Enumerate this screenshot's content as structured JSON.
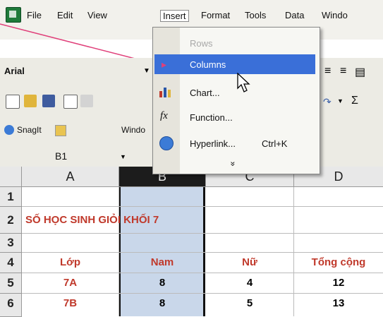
{
  "menubar": {
    "items": [
      "File",
      "Edit",
      "View",
      "Insert",
      "Format",
      "Tools",
      "Data",
      "Windo"
    ]
  },
  "font_toolbar": {
    "font_name": "Arial"
  },
  "standard_toolbar": {
    "sigma": "Σ"
  },
  "snagit_toolbar": {
    "snagit_label": "SnagIt",
    "window_label": "Windo"
  },
  "formula_bar": {
    "name_box": "B1"
  },
  "insert_menu": {
    "items": [
      {
        "label": "Rows",
        "shortcut": "",
        "disabled": true
      },
      {
        "label": "Columns",
        "shortcut": "",
        "highlighted": true
      },
      {
        "label": "Chart...",
        "shortcut": ""
      },
      {
        "label": "Function...",
        "shortcut": ""
      },
      {
        "label": "Hyperlink...",
        "shortcut": "Ctrl+K"
      }
    ],
    "more_chevron": "»"
  },
  "sheet": {
    "columns": [
      "A",
      "B",
      "C",
      "D"
    ],
    "rows": [
      {
        "n": "1",
        "cells": [
          "",
          "",
          "",
          ""
        ]
      },
      {
        "n": "2",
        "title": "SỐ HỌC SINH GIỎI KHỐI 7"
      },
      {
        "n": "3",
        "cells": [
          "",
          "",
          "",
          ""
        ]
      },
      {
        "n": "4",
        "cells": [
          "Lớp",
          "Nam",
          "Nữ",
          "Tổng cộng"
        ]
      },
      {
        "n": "5",
        "cells": [
          "7A",
          "8",
          "4",
          "12"
        ]
      },
      {
        "n": "6",
        "cells": [
          "7B",
          "8",
          "5",
          "13"
        ]
      }
    ]
  },
  "colors": {
    "highlight": "#3a6fd8",
    "selected_column": "#c9d7ea",
    "pointer": "#e0407a",
    "red_text": "#c0392b"
  }
}
